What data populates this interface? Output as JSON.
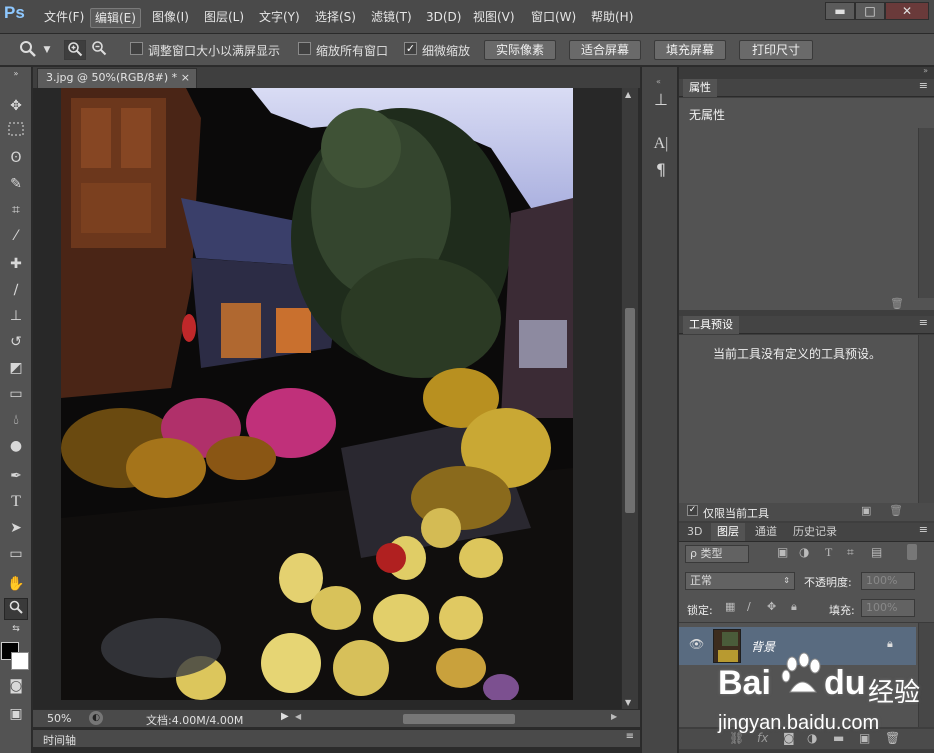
{
  "app": {
    "logo": "Ps"
  },
  "menu": {
    "items": [
      "文件(F)",
      "编辑(E)",
      "图像(I)",
      "图层(L)",
      "文字(Y)",
      "选择(S)",
      "滤镜(T)",
      "3D(D)",
      "视图(V)",
      "窗口(W)",
      "帮助(H)"
    ],
    "active_index": 1
  },
  "window_controls": {
    "minimize": "▬",
    "maximize": "□",
    "close": "✕"
  },
  "options_bar": {
    "chk_resize": "调整窗口大小以满屏显示",
    "chk_zoom_all": "缩放所有窗口",
    "chk_scrubby": "细微缩放",
    "btn_actual": "实际像素",
    "btn_fit": "适合屏幕",
    "btn_fill": "填充屏幕",
    "btn_print": "打印尺寸"
  },
  "document": {
    "tab_title": "3.jpg @ 50%(RGB/8#) *",
    "tab_close": "×",
    "zoom": "50%",
    "doc_info": "文档:4.00M/4.00M"
  },
  "timeline": {
    "label": "时间轴"
  },
  "properties_panel": {
    "title": "属性",
    "message": "无属性"
  },
  "tool_presets_panel": {
    "title": "工具预设",
    "message": "当前工具没有定义的工具预设。",
    "only_current": "仅限当前工具"
  },
  "layers_panel": {
    "tabs": [
      "3D",
      "图层",
      "通道",
      "历史记录"
    ],
    "active_tab": 1,
    "filter_kind": "ρ 类型",
    "blend_mode": "正常",
    "opacity_label": "不透明度:",
    "opacity_value": "100%",
    "lock_label": "锁定:",
    "fill_label": "填充:",
    "fill_value": "100%",
    "layer_name": "背景"
  },
  "watermark": {
    "brand": "Bai",
    "brand2": "du",
    "cn": "经验",
    "url": "jingyan.baidu.com"
  },
  "colors": {
    "accent_ps": "#8ec8ff",
    "layer_selected": "#596b80"
  }
}
